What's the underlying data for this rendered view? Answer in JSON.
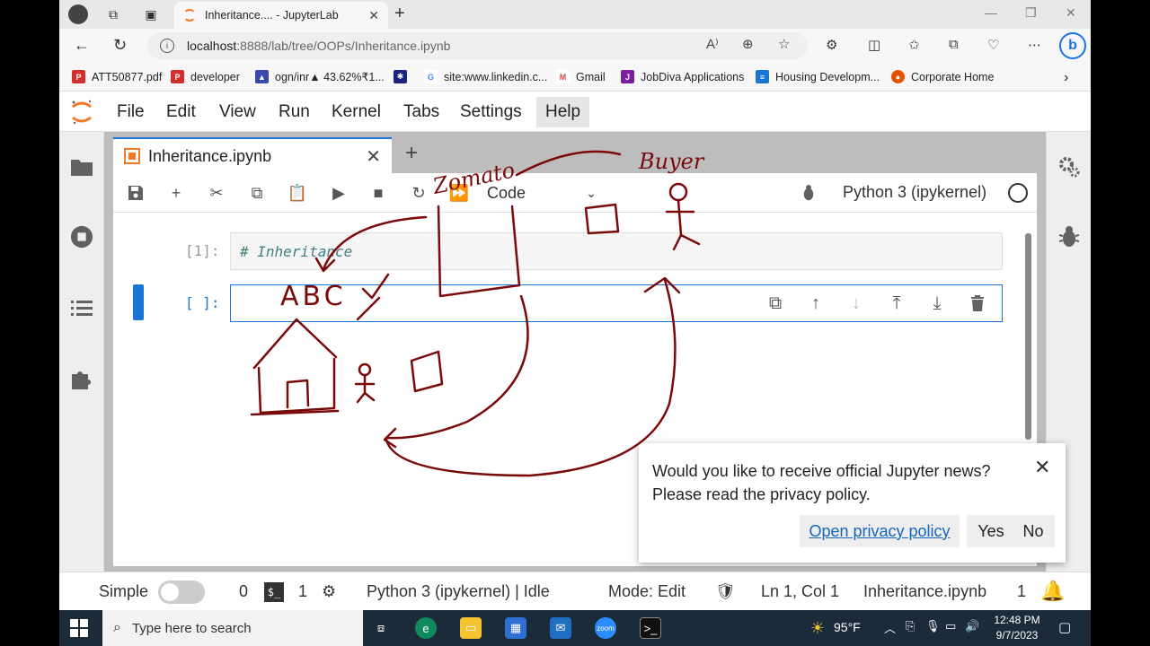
{
  "browser": {
    "tab_title": "Inheritance.... - JupyterLab",
    "url_host": "localhost",
    "url_rest": ":8888/lab/tree/OOPs/Inheritance.ipynb"
  },
  "bookmarks": [
    {
      "label": "ATT50877.pdf",
      "color": "#d32f2f",
      "icon": "pdf-icon"
    },
    {
      "label": "developer",
      "color": "#d32f2f",
      "icon": "pdf-icon"
    },
    {
      "label": "ogn/inr▲ 43.62%₹1...",
      "color": "#3949ab",
      "icon": "chart-icon"
    },
    {
      "label": "",
      "color": "#1a237e",
      "icon": "star-badge-icon"
    },
    {
      "label": "site:www.linkedin.c...",
      "color": "#4285f4",
      "icon": "google-icon"
    },
    {
      "label": "Gmail",
      "color": "#ea4335",
      "icon": "gmail-icon"
    },
    {
      "label": "JobDiva Applications",
      "color": "#7b1fa2",
      "icon": "jobdiva-icon"
    },
    {
      "label": "Housing Developm...",
      "color": "#1976d2",
      "icon": "housing-icon"
    },
    {
      "label": "Corporate Home",
      "color": "#e65100",
      "icon": "corporate-icon"
    }
  ],
  "menu": [
    "File",
    "Edit",
    "View",
    "Run",
    "Kernel",
    "Tabs",
    "Settings",
    "Help"
  ],
  "notebook": {
    "tab_title": "Inheritance.ipynb",
    "cell_type": "Code",
    "kernel": "Python 3 (ipykernel)",
    "cells": [
      {
        "prompt": "[1]:",
        "source": "# Inheritance"
      },
      {
        "prompt": "[ ]:",
        "source": ""
      }
    ]
  },
  "notification": {
    "message_line1": "Would you like to receive official Jupyter news?",
    "message_line2": "Please read the privacy policy.",
    "privacy_label": "Open privacy policy",
    "yes_label": "Yes",
    "no_label": "No"
  },
  "statusbar": {
    "simple_label": "Simple",
    "terminals": "0",
    "kernels": "1",
    "kernel_status": "Python 3 (ipykernel) | Idle",
    "mode": "Mode: Edit",
    "cursor": "Ln 1, Col 1",
    "file": "Inheritance.ipynb",
    "notifications": "1"
  },
  "taskbar": {
    "search_placeholder": "Type here to search",
    "weather": "95°F",
    "time": "12:48 PM",
    "date": "9/7/2023"
  },
  "annotations": {
    "company_label": "Zomato",
    "buyer_label": "Buyer",
    "abc_label": "ABC"
  },
  "colors": {
    "accent": "#1976d2",
    "jupyter_orange": "#f37726",
    "ink": "#7a0a0a"
  }
}
